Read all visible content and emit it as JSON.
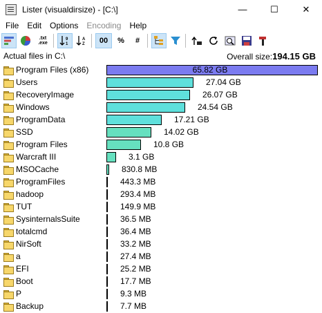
{
  "window": {
    "title": "Lister (visualdirsize) - [C:\\]",
    "minimize": "—",
    "maximize": "☐",
    "close": "✕"
  },
  "menu": [
    {
      "label": "File",
      "disabled": false
    },
    {
      "label": "Edit",
      "disabled": false
    },
    {
      "label": "Options",
      "disabled": false
    },
    {
      "label": "Encoding",
      "disabled": true
    },
    {
      "label": "Help",
      "disabled": false
    }
  ],
  "toolbar": {
    "percent_label": "%",
    "hash_label": "#",
    "zero_label": "00",
    "ext_label": ".txt .exe",
    "sort_asc_label": "↓1↑",
    "sort_desc_label": "↓AZ"
  },
  "header": {
    "left": "Actual files in C:\\",
    "right_prefix": "Overall size:",
    "right_value": "194.15 GB"
  },
  "colors": {
    "top_bar": "#7b7bf0",
    "bar": "#5fe0dc",
    "bar_mid": "#66e0bf"
  },
  "rows": [
    {
      "name": "Program Files (x86)",
      "size": "65.82 GB",
      "value_gb": 65.82
    },
    {
      "name": "Users",
      "size": "27.04 GB",
      "value_gb": 27.04
    },
    {
      "name": "RecoveryImage",
      "size": "26.07 GB",
      "value_gb": 26.07
    },
    {
      "name": "Windows",
      "size": "24.54 GB",
      "value_gb": 24.54
    },
    {
      "name": "ProgramData",
      "size": "17.21 GB",
      "value_gb": 17.21
    },
    {
      "name": "SSD",
      "size": "14.02 GB",
      "value_gb": 14.02
    },
    {
      "name": "Program Files",
      "size": "10.8 GB",
      "value_gb": 10.8
    },
    {
      "name": "Warcraft III",
      "size": "3.1 GB",
      "value_gb": 3.1
    },
    {
      "name": "MSOCache",
      "size": "830.8 MB",
      "value_gb": 0.8113
    },
    {
      "name": "ProgramFiles",
      "size": "443.3 MB",
      "value_gb": 0.4329
    },
    {
      "name": "hadoop",
      "size": "293.4 MB",
      "value_gb": 0.2865
    },
    {
      "name": "TUT",
      "size": "149.9 MB",
      "value_gb": 0.1464
    },
    {
      "name": "SysinternalsSuite",
      "size": "36.5 MB",
      "value_gb": 0.0356
    },
    {
      "name": "totalcmd",
      "size": "36.4 MB",
      "value_gb": 0.0355
    },
    {
      "name": "NirSoft",
      "size": "33.2 MB",
      "value_gb": 0.0324
    },
    {
      "name": "a",
      "size": "27.4 MB",
      "value_gb": 0.0268
    },
    {
      "name": "EFI",
      "size": "25.2 MB",
      "value_gb": 0.0246
    },
    {
      "name": "Boot",
      "size": "17.7 MB",
      "value_gb": 0.0173
    },
    {
      "name": "P",
      "size": "9.3 MB",
      "value_gb": 0.0091
    },
    {
      "name": "Backup",
      "size": "7.7 MB",
      "value_gb": 0.0075
    }
  ]
}
